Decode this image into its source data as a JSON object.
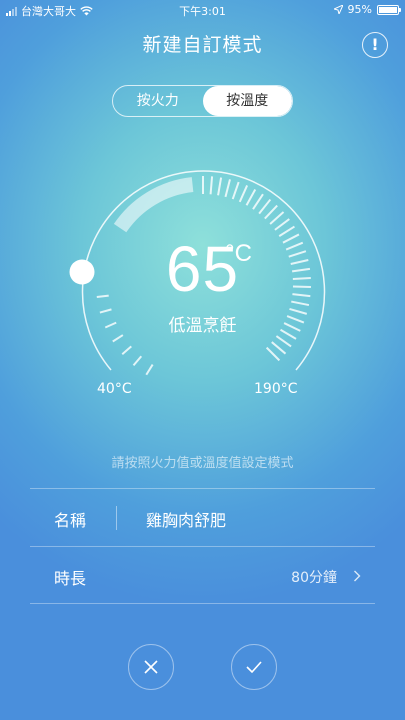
{
  "status_bar": {
    "carrier": "台灣大哥大",
    "time": "下午3:01",
    "battery": "95%"
  },
  "header": {
    "title": "新建自訂模式",
    "info_glyph": "!"
  },
  "segment": {
    "options": [
      "按火力",
      "按溫度"
    ],
    "selected_index": 1
  },
  "dial": {
    "value": "65",
    "unit": "°C",
    "mode_label": "低溫烹飪",
    "min_label": "40°C",
    "max_label": "190°C",
    "min": 40,
    "max": 190,
    "current": 65
  },
  "hint": "請按照火力值或溫度值設定模式",
  "fields": {
    "name": {
      "label": "名稱",
      "value": "雞胸肉舒肥"
    },
    "duration": {
      "label": "時長",
      "value": "80分鐘"
    }
  },
  "icons": {
    "signal": "signal-bars-icon",
    "wifi": "wifi-icon",
    "location": "location-arrow-icon",
    "battery": "battery-icon",
    "info": "info-icon",
    "chevron": "chevron-right-icon",
    "cancel": "close-icon",
    "confirm": "checkmark-icon"
  },
  "colors": {
    "bg_top": "#8ee0da",
    "bg_bottom": "#4a8fdc",
    "active_segment": "#ffffff"
  }
}
